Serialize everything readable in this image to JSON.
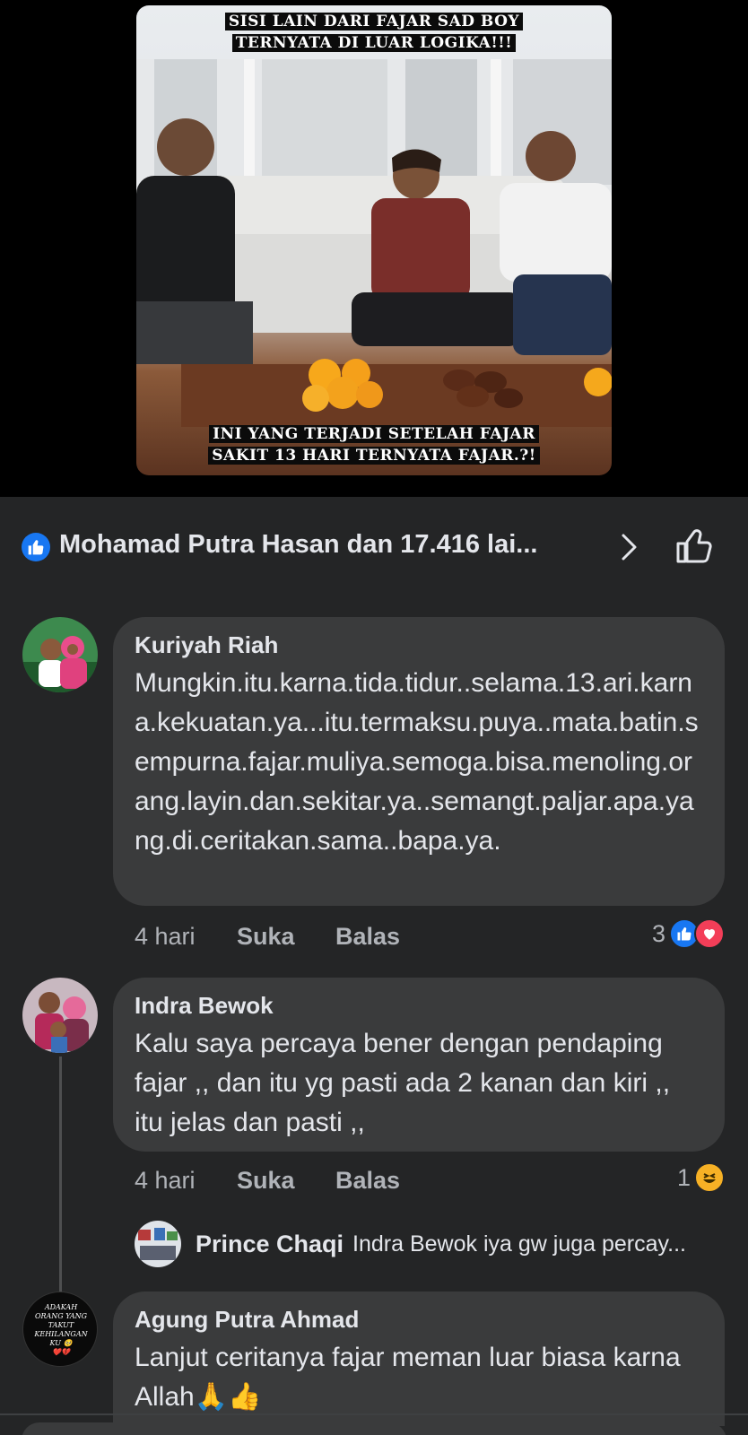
{
  "video": {
    "caption_top_line1": "SISI LAIN DARI FAJAR SAD BOY",
    "caption_top_line2": "TERNYATA DI LUAR LOGIKA!!!",
    "caption_bottom_line1": "INI YANG TERJADI SETELAH FAJAR",
    "caption_bottom_line2": "SAKIT 13 HARI TERNYATA FAJAR.?!"
  },
  "reactions": {
    "summary": "Mohamad Putra Hasan dan 17.416 lai...",
    "icon": "like-icon",
    "accent": "#1877f2"
  },
  "comments": [
    {
      "author": "Kuriyah Riah",
      "text": "Mungkin.itu.karna.tida.tidur..selama.13.ari.karna.kekuatan.ya...itu.termaksu.puya..mata.batin.sempurna.fajar.muliya.semoga.bisa.menoling.orang.layin.dan.sekitar.ya..semangt.paljar.apa.yang.di.ceritakan.sama..bapa.ya.",
      "time": "4 hari",
      "like_label": "Suka",
      "reply_label": "Balas",
      "reaction_count": "3",
      "reaction_icons": [
        "like-icon",
        "love-icon"
      ]
    },
    {
      "author": "Indra Bewok",
      "text": "Kalu saya percaya bener dengan pendaping fajar ,, dan itu yg pasti ada 2 kanan dan kiri ,, itu jelas dan pasti ,,",
      "time": "4 hari",
      "like_label": "Suka",
      "reply_label": "Balas",
      "reaction_count": "1",
      "reaction_icons": [
        "haha-icon"
      ],
      "reply_preview": {
        "author": "Prince Chaqi",
        "text": "Indra Bewok iya gw juga percay..."
      }
    },
    {
      "author": "Agung Putra Ahmad",
      "text": "Lanjut ceritanya fajar meman luar biasa karna Allah🙏👍",
      "avatar_text_line1": "ADAKAH",
      "avatar_text_line2": "ORANG YANG",
      "avatar_text_line3": "TAKUT",
      "avatar_text_line4": "KEHILANGAN",
      "avatar_text_line5": "KU 🥺",
      "avatar_text_line6": "❤️💔"
    }
  ],
  "colors": {
    "background": "#242526",
    "bubble": "#3a3b3c",
    "text_primary": "#e4e6eb",
    "text_secondary": "#b0b3b8",
    "love": "#f33e58",
    "haha": "#f7b125"
  }
}
